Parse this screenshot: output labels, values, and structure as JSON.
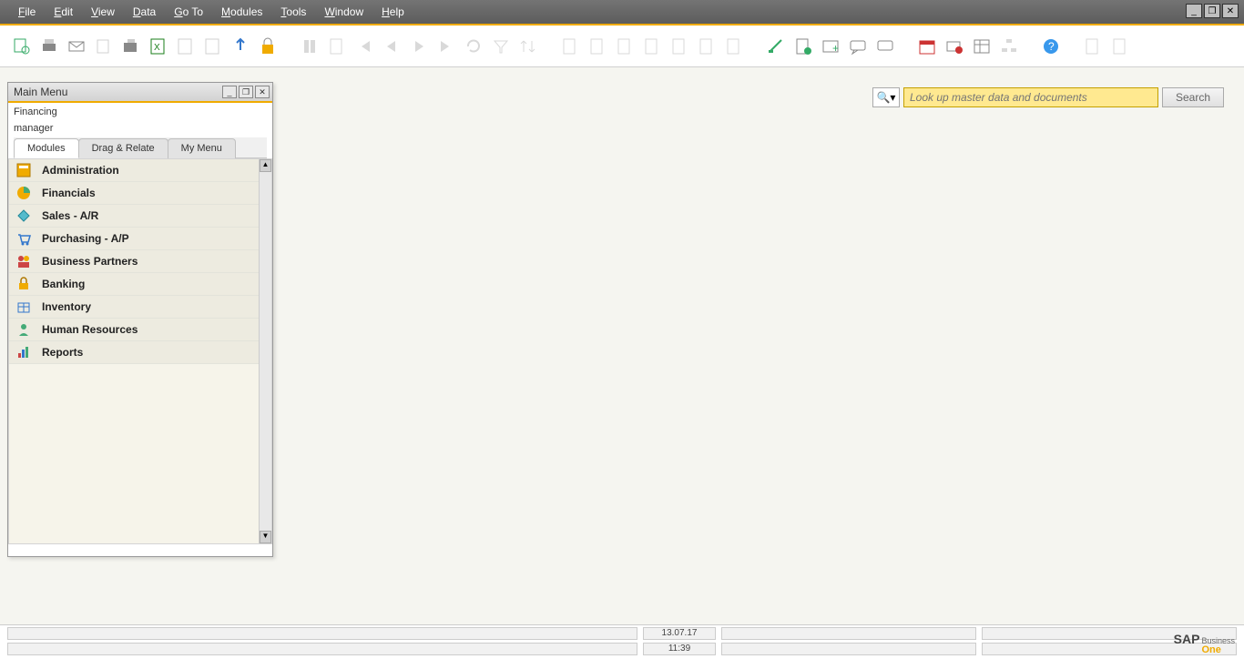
{
  "menubar": {
    "items": [
      "File",
      "Edit",
      "View",
      "Data",
      "Go To",
      "Modules",
      "Tools",
      "Window",
      "Help"
    ]
  },
  "search": {
    "placeholder": "Look up master data and documents",
    "button": "Search"
  },
  "main_menu": {
    "title": "Main Menu",
    "company": "Financing",
    "user": "manager",
    "tabs": [
      "Modules",
      "Drag & Relate",
      "My Menu"
    ],
    "items": [
      {
        "label": "Administration",
        "icon": "admin"
      },
      {
        "label": "Financials",
        "icon": "pie"
      },
      {
        "label": "Sales - A/R",
        "icon": "sales"
      },
      {
        "label": "Purchasing - A/P",
        "icon": "cart"
      },
      {
        "label": "Business Partners",
        "icon": "people"
      },
      {
        "label": "Banking",
        "icon": "lock"
      },
      {
        "label": "Inventory",
        "icon": "box"
      },
      {
        "label": "Human Resources",
        "icon": "person"
      },
      {
        "label": "Reports",
        "icon": "chart"
      }
    ]
  },
  "status": {
    "date": "13.07.17",
    "time": "11:39"
  },
  "logo": {
    "brand": "SAP",
    "suffix": "Business",
    "product": "One"
  }
}
